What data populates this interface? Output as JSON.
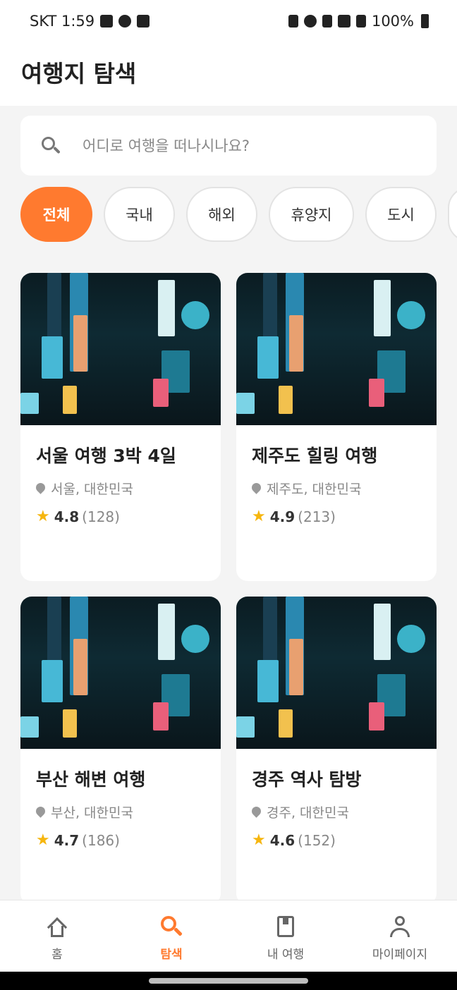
{
  "status_bar": {
    "carrier_time": "SKT 1:59",
    "battery": "100%"
  },
  "header": {
    "title": "여행지 탐색"
  },
  "search": {
    "placeholder": "어디로 여행을 떠나시나요?"
  },
  "categories": {
    "items": [
      {
        "label": "전체",
        "active": true
      },
      {
        "label": "국내"
      },
      {
        "label": "해외"
      },
      {
        "label": "휴양지"
      },
      {
        "label": "도시"
      }
    ]
  },
  "destinations": [
    {
      "title": "서울 여행 3박 4일",
      "location": "서울, 대한민국",
      "rating": "4.8",
      "reviews": "(128)"
    },
    {
      "title": "제주도 힐링 여행",
      "location": "제주도, 대한민국",
      "rating": "4.9",
      "reviews": "(213)"
    },
    {
      "title": "부산 해변 여행",
      "location": "부산, 대한민국",
      "rating": "4.7",
      "reviews": "(186)"
    },
    {
      "title": "경주 역사 탐방",
      "location": "경주, 대한민국",
      "rating": "4.6",
      "reviews": "(152)"
    }
  ],
  "bottom_nav": {
    "items": [
      {
        "label": "홈",
        "icon": "home-icon"
      },
      {
        "label": "탐색",
        "icon": "search-icon",
        "active": true
      },
      {
        "label": "내 여행",
        "icon": "bookmark-icon"
      },
      {
        "label": "마이페이지",
        "icon": "person-icon"
      }
    ]
  },
  "colors": {
    "accent": "#ff7a2f",
    "star": "#f6b60f"
  }
}
